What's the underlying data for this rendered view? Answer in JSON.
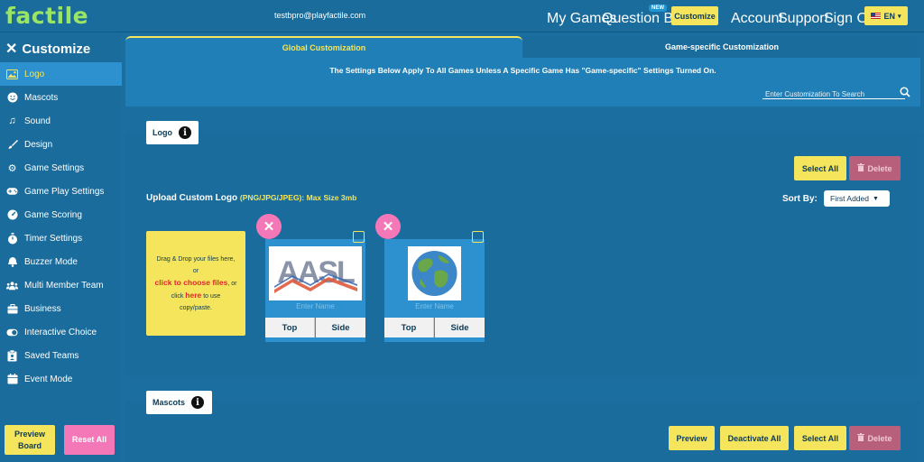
{
  "app": {
    "logo": "factile",
    "email": "testbpro@playfactile.com"
  },
  "nav": {
    "my_games": "My Games",
    "question_banks": "Question Banks",
    "new_badge": "NEW",
    "customize": "Customize",
    "account": "Account",
    "support": "Support",
    "sign_out": "Sign Out",
    "language": "EN"
  },
  "sidebar": {
    "title": "Customize",
    "items": [
      {
        "label": "Logo",
        "icon": "image-icon"
      },
      {
        "label": "Mascots",
        "icon": "smiley-icon"
      },
      {
        "label": "Sound",
        "icon": "music-icon"
      },
      {
        "label": "Design",
        "icon": "brush-icon"
      },
      {
        "label": "Game Settings",
        "icon": "gear-icon"
      },
      {
        "label": "Game Play Settings",
        "icon": "gamepad-icon"
      },
      {
        "label": "Game Scoring",
        "icon": "gauge-icon"
      },
      {
        "label": "Timer Settings",
        "icon": "stopwatch-icon"
      },
      {
        "label": "Buzzer Mode",
        "icon": "bell-icon"
      },
      {
        "label": "Multi Member Team",
        "icon": "users-icon"
      },
      {
        "label": "Business",
        "icon": "briefcase-icon"
      },
      {
        "label": "Interactive Choice",
        "icon": "toggle-icon"
      },
      {
        "label": "Saved Teams",
        "icon": "clipboard-icon"
      },
      {
        "label": "Event Mode",
        "icon": "calendar-icon"
      }
    ],
    "preview_board": "Preview Board",
    "reset_all": "Reset All"
  },
  "tabs": {
    "global": "Global Customization",
    "specific": "Game-specific Customization"
  },
  "notice": "The Settings Below Apply To All Games Unless A Specific Game Has \"Game-specific\" Settings Turned On.",
  "search": {
    "placeholder": "Enter Customization To Search"
  },
  "logo_section": {
    "tag": "Logo",
    "select_all": "Select All",
    "delete": "Delete",
    "upload_title": "Upload Custom Logo",
    "upload_sub": "(PNG/JPG/JPEG): Max Size 3mb",
    "sort_by": "Sort By:",
    "sort_value": "First Added",
    "dropzone": {
      "line1": "Drag & Drop your files here,",
      "line2": "or",
      "link1": "click to choose files",
      "line3": ", or",
      "line4a": "click",
      "link2": "here",
      "line4b": "to use",
      "line5": "copy/paste."
    },
    "cards": [
      {
        "placeholder": "Enter Name",
        "top": "Top",
        "side": "Side",
        "image": "AASL"
      },
      {
        "placeholder": "Enter Name",
        "top": "Top",
        "side": "Side",
        "image": "globe-image"
      }
    ]
  },
  "mascots_section": {
    "tag": "Mascots",
    "preview": "Preview",
    "deactivate_all": "Deactivate All",
    "select_all": "Select All",
    "delete": "Delete"
  },
  "colors": {
    "accent": "#f5e55c",
    "pink": "#f477b8",
    "brand_green": "#9be564",
    "bg": "#1b6fa0"
  }
}
